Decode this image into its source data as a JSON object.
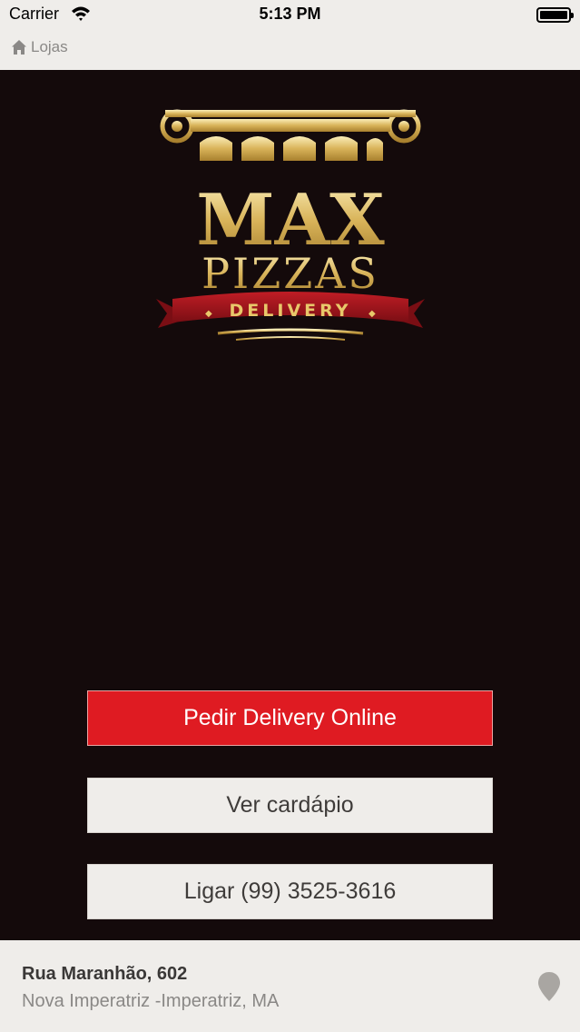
{
  "status_bar": {
    "carrier": "Carrier",
    "time": "5:13 PM"
  },
  "nav": {
    "back_label": "Lojas",
    "back_icon": "home-icon"
  },
  "logo": {
    "name": "MAX",
    "name2": "PIZZAS",
    "tagline": "DELIVERY"
  },
  "buttons": {
    "delivery": "Pedir Delivery Online",
    "menu": "Ver cardápio",
    "call": "Ligar (99) 3525-3616"
  },
  "footer": {
    "street": "Rua Maranhão, 602",
    "city": "Nova Imperatriz -Imperatriz, MA",
    "pin_icon": "map-pin-icon"
  },
  "colors": {
    "primary": "#df1b22",
    "background": "#140a0b",
    "gold": "#d9b45a",
    "ribbon": "#a6161e"
  }
}
